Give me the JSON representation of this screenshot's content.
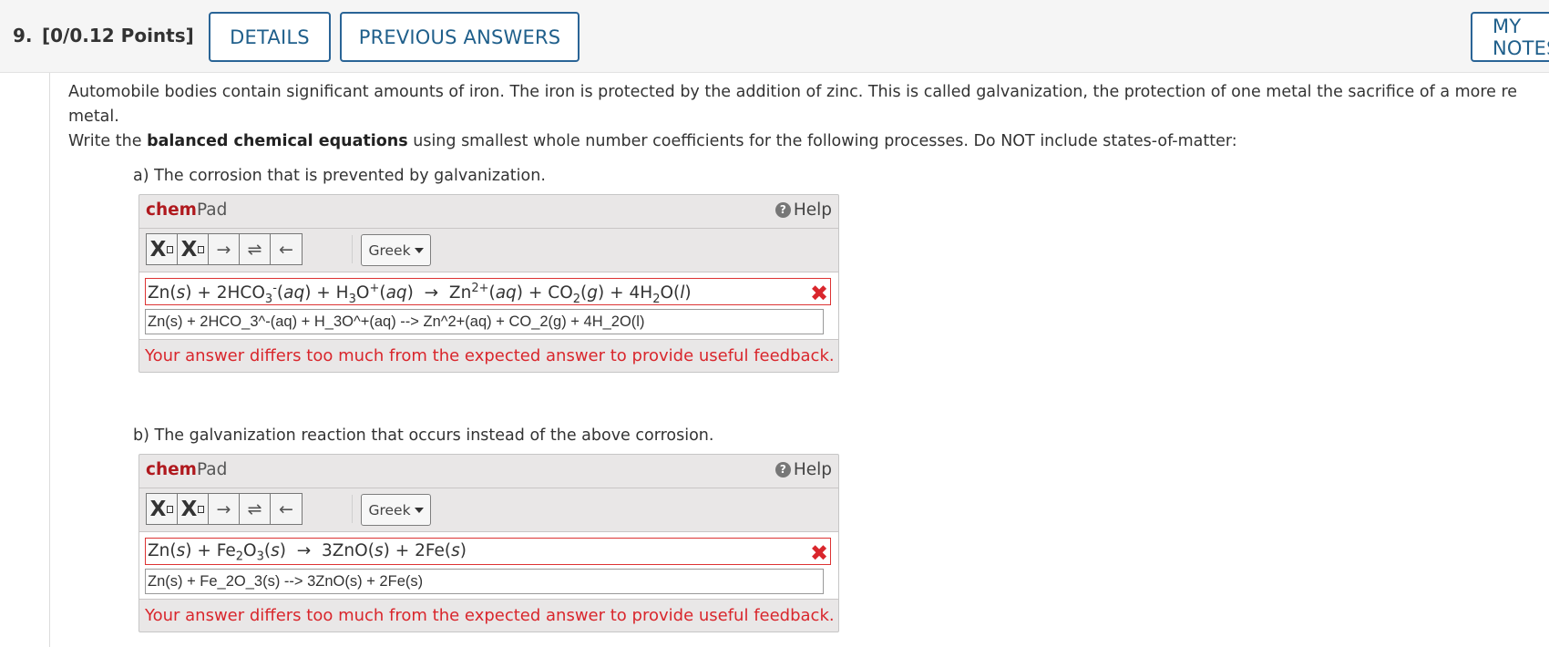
{
  "header": {
    "number": "9.",
    "points": "[0/0.12 Points]",
    "details_label": "DETAILS",
    "previous_answers_label": "PREVIOUS ANSWERS",
    "my_notes_label": "MY NOTES"
  },
  "question": {
    "line1": "Automobile bodies contain significant amounts of iron. The iron is protected by the addition of zinc. This is called galvanization, the protection of one metal the sacrifice of a more re",
    "line2": "metal.",
    "instr_pre": "Write the ",
    "instr_bold": "balanced chemical equations",
    "instr_post": " using smallest whole number coefficients for the following processes. Do NOT include states-of-matter:"
  },
  "parts": [
    {
      "prompt": "a) The corrosion that is prevented by galvanization.",
      "chempad": {
        "brand_chem": "chem",
        "brand_pad": "Pad",
        "help_label": "Help",
        "greek_label": "Greek",
        "input_value": "Zn(s) + 2HCO_3^-(aq) + H_3O^+(aq) --> Zn^2+(aq) + CO_2(g) + 4H_2O(l)",
        "feedback": "Your answer differs too much from the expected answer to provide useful feedback."
      }
    },
    {
      "prompt": "b) The galvanization reaction that occurs instead of the above corrosion.",
      "chempad": {
        "brand_chem": "chem",
        "brand_pad": "Pad",
        "help_label": "Help",
        "greek_label": "Greek",
        "input_value": "Zn(s) + Fe_2O_3(s) --> 3ZnO(s) + 2Fe(s)",
        "feedback": "Your answer differs too much from the expected answer to provide useful feedback."
      }
    }
  ],
  "colors": {
    "accent_blue": "#1f5f8b",
    "error_red": "#d9262c",
    "brand_red": "#b0191e"
  },
  "icons": {
    "help": "question-circle-icon",
    "wrong": "x-mark-icon"
  }
}
